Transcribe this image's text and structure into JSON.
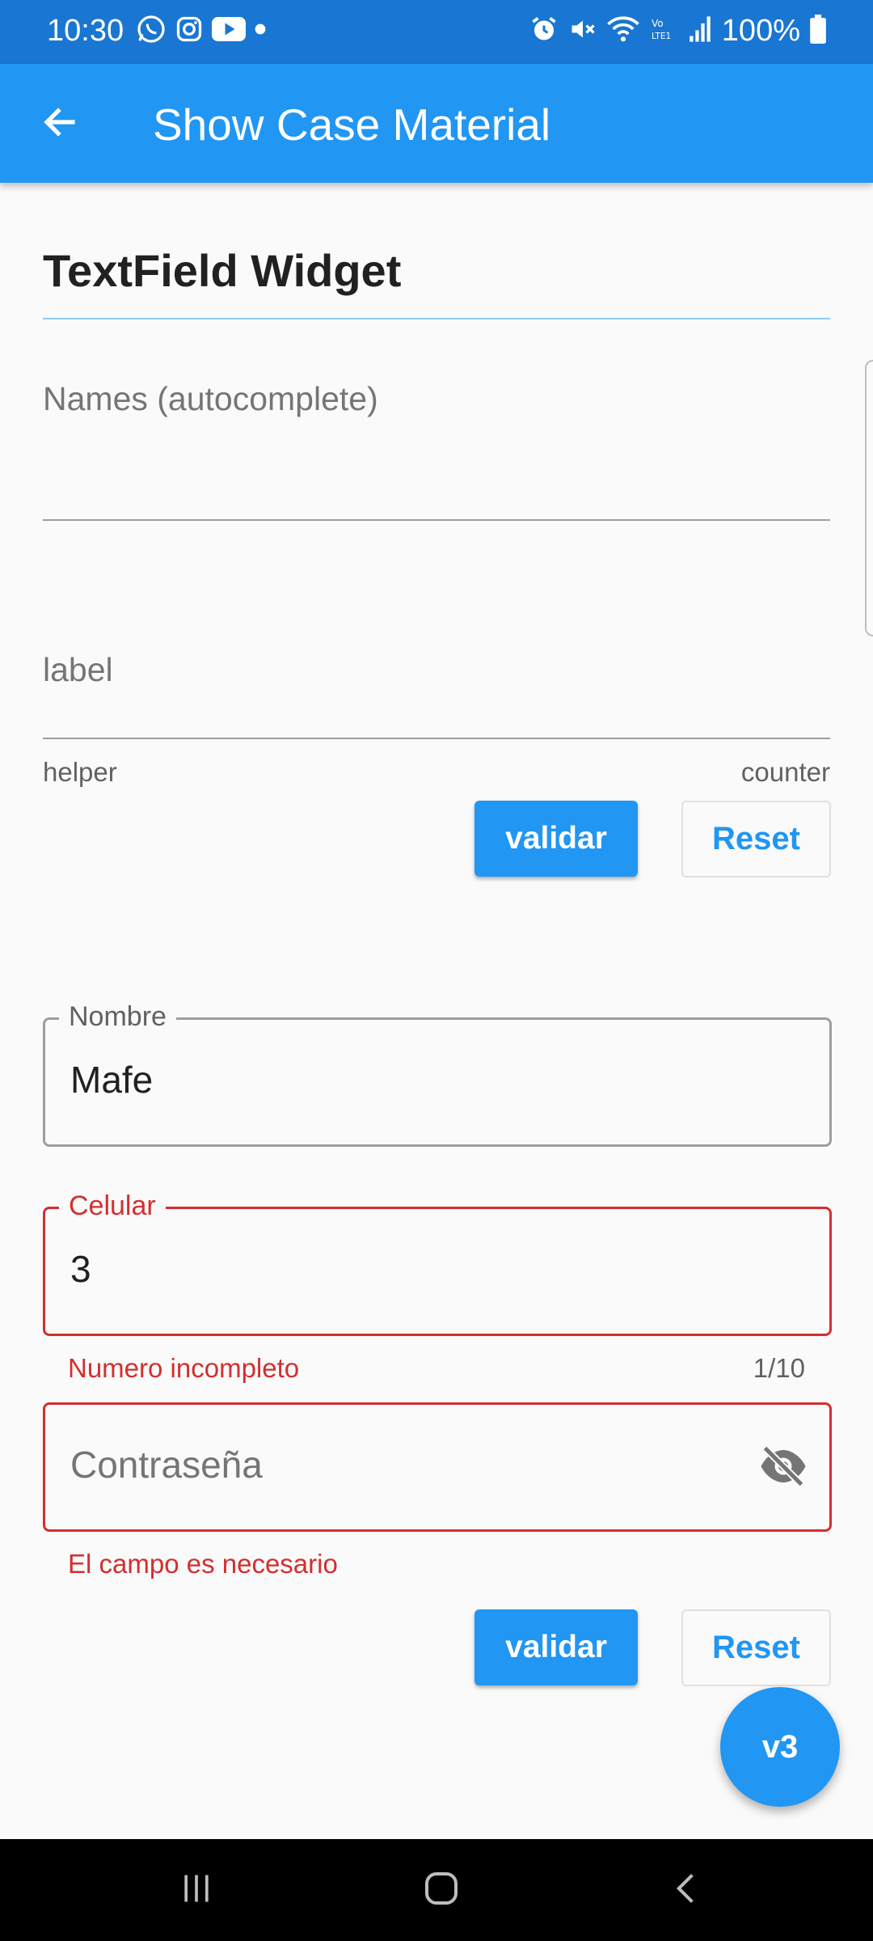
{
  "status_bar": {
    "time": "10:30",
    "battery": "100%",
    "icons": [
      "whatsapp-icon",
      "instagram-icon",
      "youtube-icon",
      "dot-icon",
      "alarm-icon",
      "mute-icon",
      "wifi-icon",
      "volte-icon",
      "signal-icon",
      "battery-icon"
    ]
  },
  "app_bar": {
    "title": "Show Case Material",
    "back_icon": "arrow-back-icon"
  },
  "content": {
    "section_title": "TextField Widget",
    "names_field": {
      "label": "Names (autocomplete)",
      "value": ""
    },
    "label_field": {
      "label": "label",
      "helper": "helper",
      "counter": "counter",
      "value": ""
    },
    "buttons_1": {
      "validate": "validar",
      "reset": "Reset"
    },
    "nombre_field": {
      "label": "Nombre",
      "value": "Mafe"
    },
    "celular_field": {
      "label": "Celular",
      "value": "3",
      "error": "Numero incompleto",
      "counter": "1/10"
    },
    "password_field": {
      "placeholder": "Contraseña",
      "error": "El campo es necesario",
      "toggle_icon": "visibility-off-icon"
    },
    "buttons_2": {
      "validate": "validar",
      "reset": "Reset"
    }
  },
  "fab": {
    "label": "v3"
  },
  "nav_bar": {
    "icons": [
      "recents-icon",
      "home-icon",
      "back-icon"
    ]
  },
  "colors": {
    "primary": "#2196f3",
    "status_bar": "#1976d2",
    "error": "#d32f2f",
    "background": "#fafafa"
  }
}
